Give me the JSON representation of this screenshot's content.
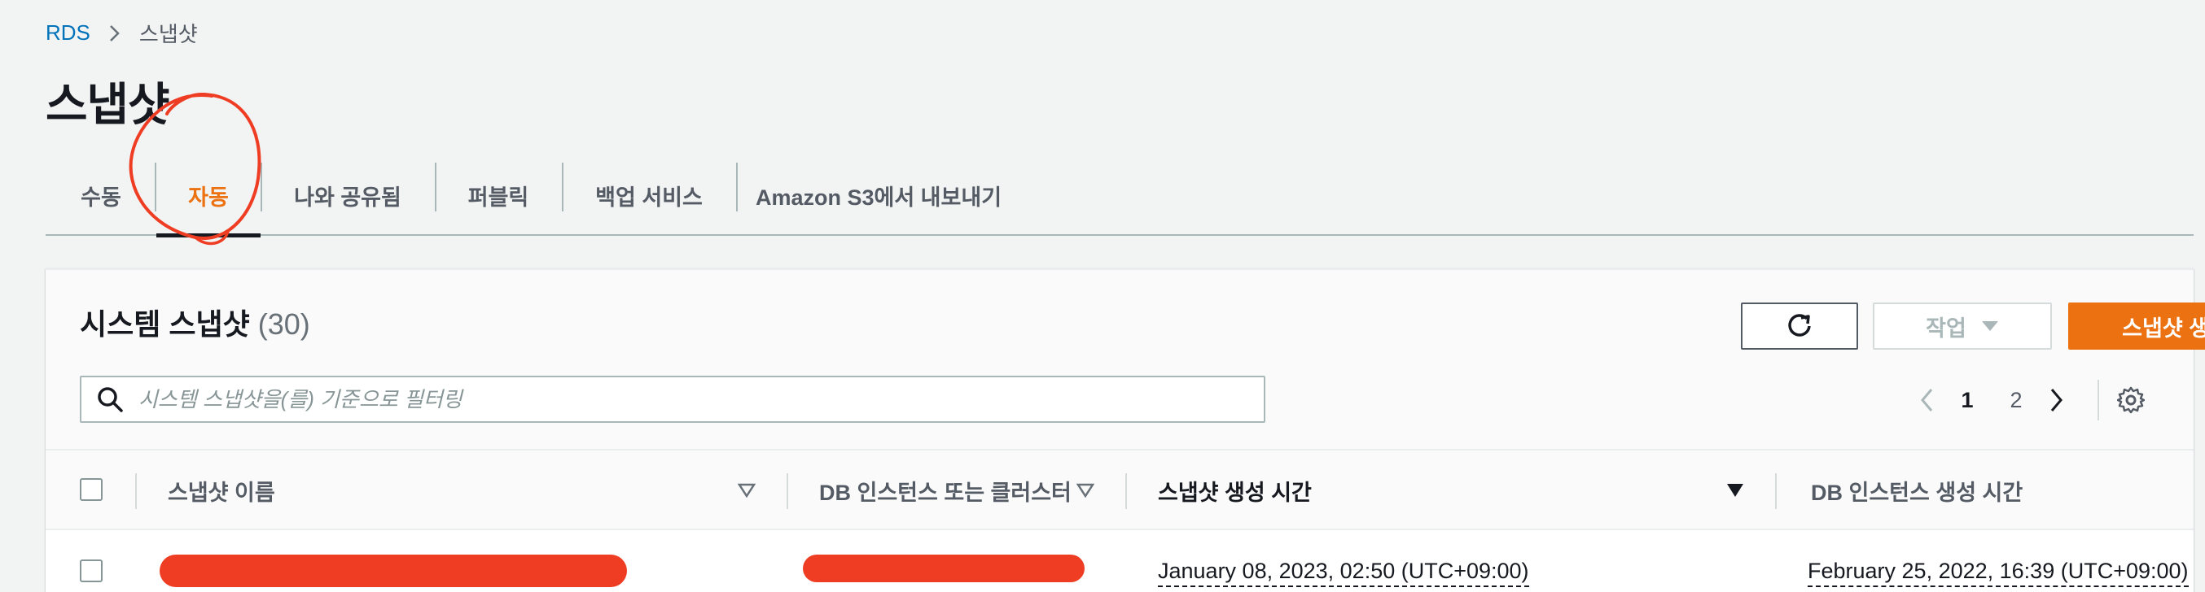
{
  "breadcrumb": {
    "root": "RDS",
    "current": "스냅샷"
  },
  "page": {
    "title": "스냅샷"
  },
  "tabs": [
    {
      "label": "수동"
    },
    {
      "label": "자동",
      "active": true
    },
    {
      "label": "나와 공유됨"
    },
    {
      "label": "퍼블릭"
    },
    {
      "label": "백업 서비스"
    },
    {
      "label": "Amazon S3에서 내보내기"
    }
  ],
  "panel": {
    "title": "시스템 스냅샷",
    "count": "(30)",
    "actions_label": "작업",
    "create_label": "스냅샷 생성",
    "search_placeholder": "시스템 스냅샷을(를) 기준으로 필터링"
  },
  "pagination": {
    "pages": [
      "1",
      "2"
    ],
    "current": "1"
  },
  "table": {
    "columns": [
      "스냅샷 이름",
      "DB 인스턴스 또는 클러스터",
      "스냅샷 생성 시간",
      "DB 인스턴스 생성 시간"
    ],
    "rows": [
      {
        "snapshot_name": "",
        "db_instance": "",
        "snapshot_time": "January 08, 2023, 02:50 (UTC+09:00)",
        "instance_time": "February 25, 2022, 16:39 (UTC+09:00)"
      }
    ]
  },
  "colors": {
    "accent": "#ec7211",
    "link": "#0073bb",
    "annotation": "#ee3d23"
  },
  "icons": [
    "chevron-right-icon",
    "refresh-icon",
    "caret-down-icon",
    "search-icon",
    "chevron-left-icon",
    "settings-icon",
    "sort-icon",
    "sort-desc-icon"
  ]
}
